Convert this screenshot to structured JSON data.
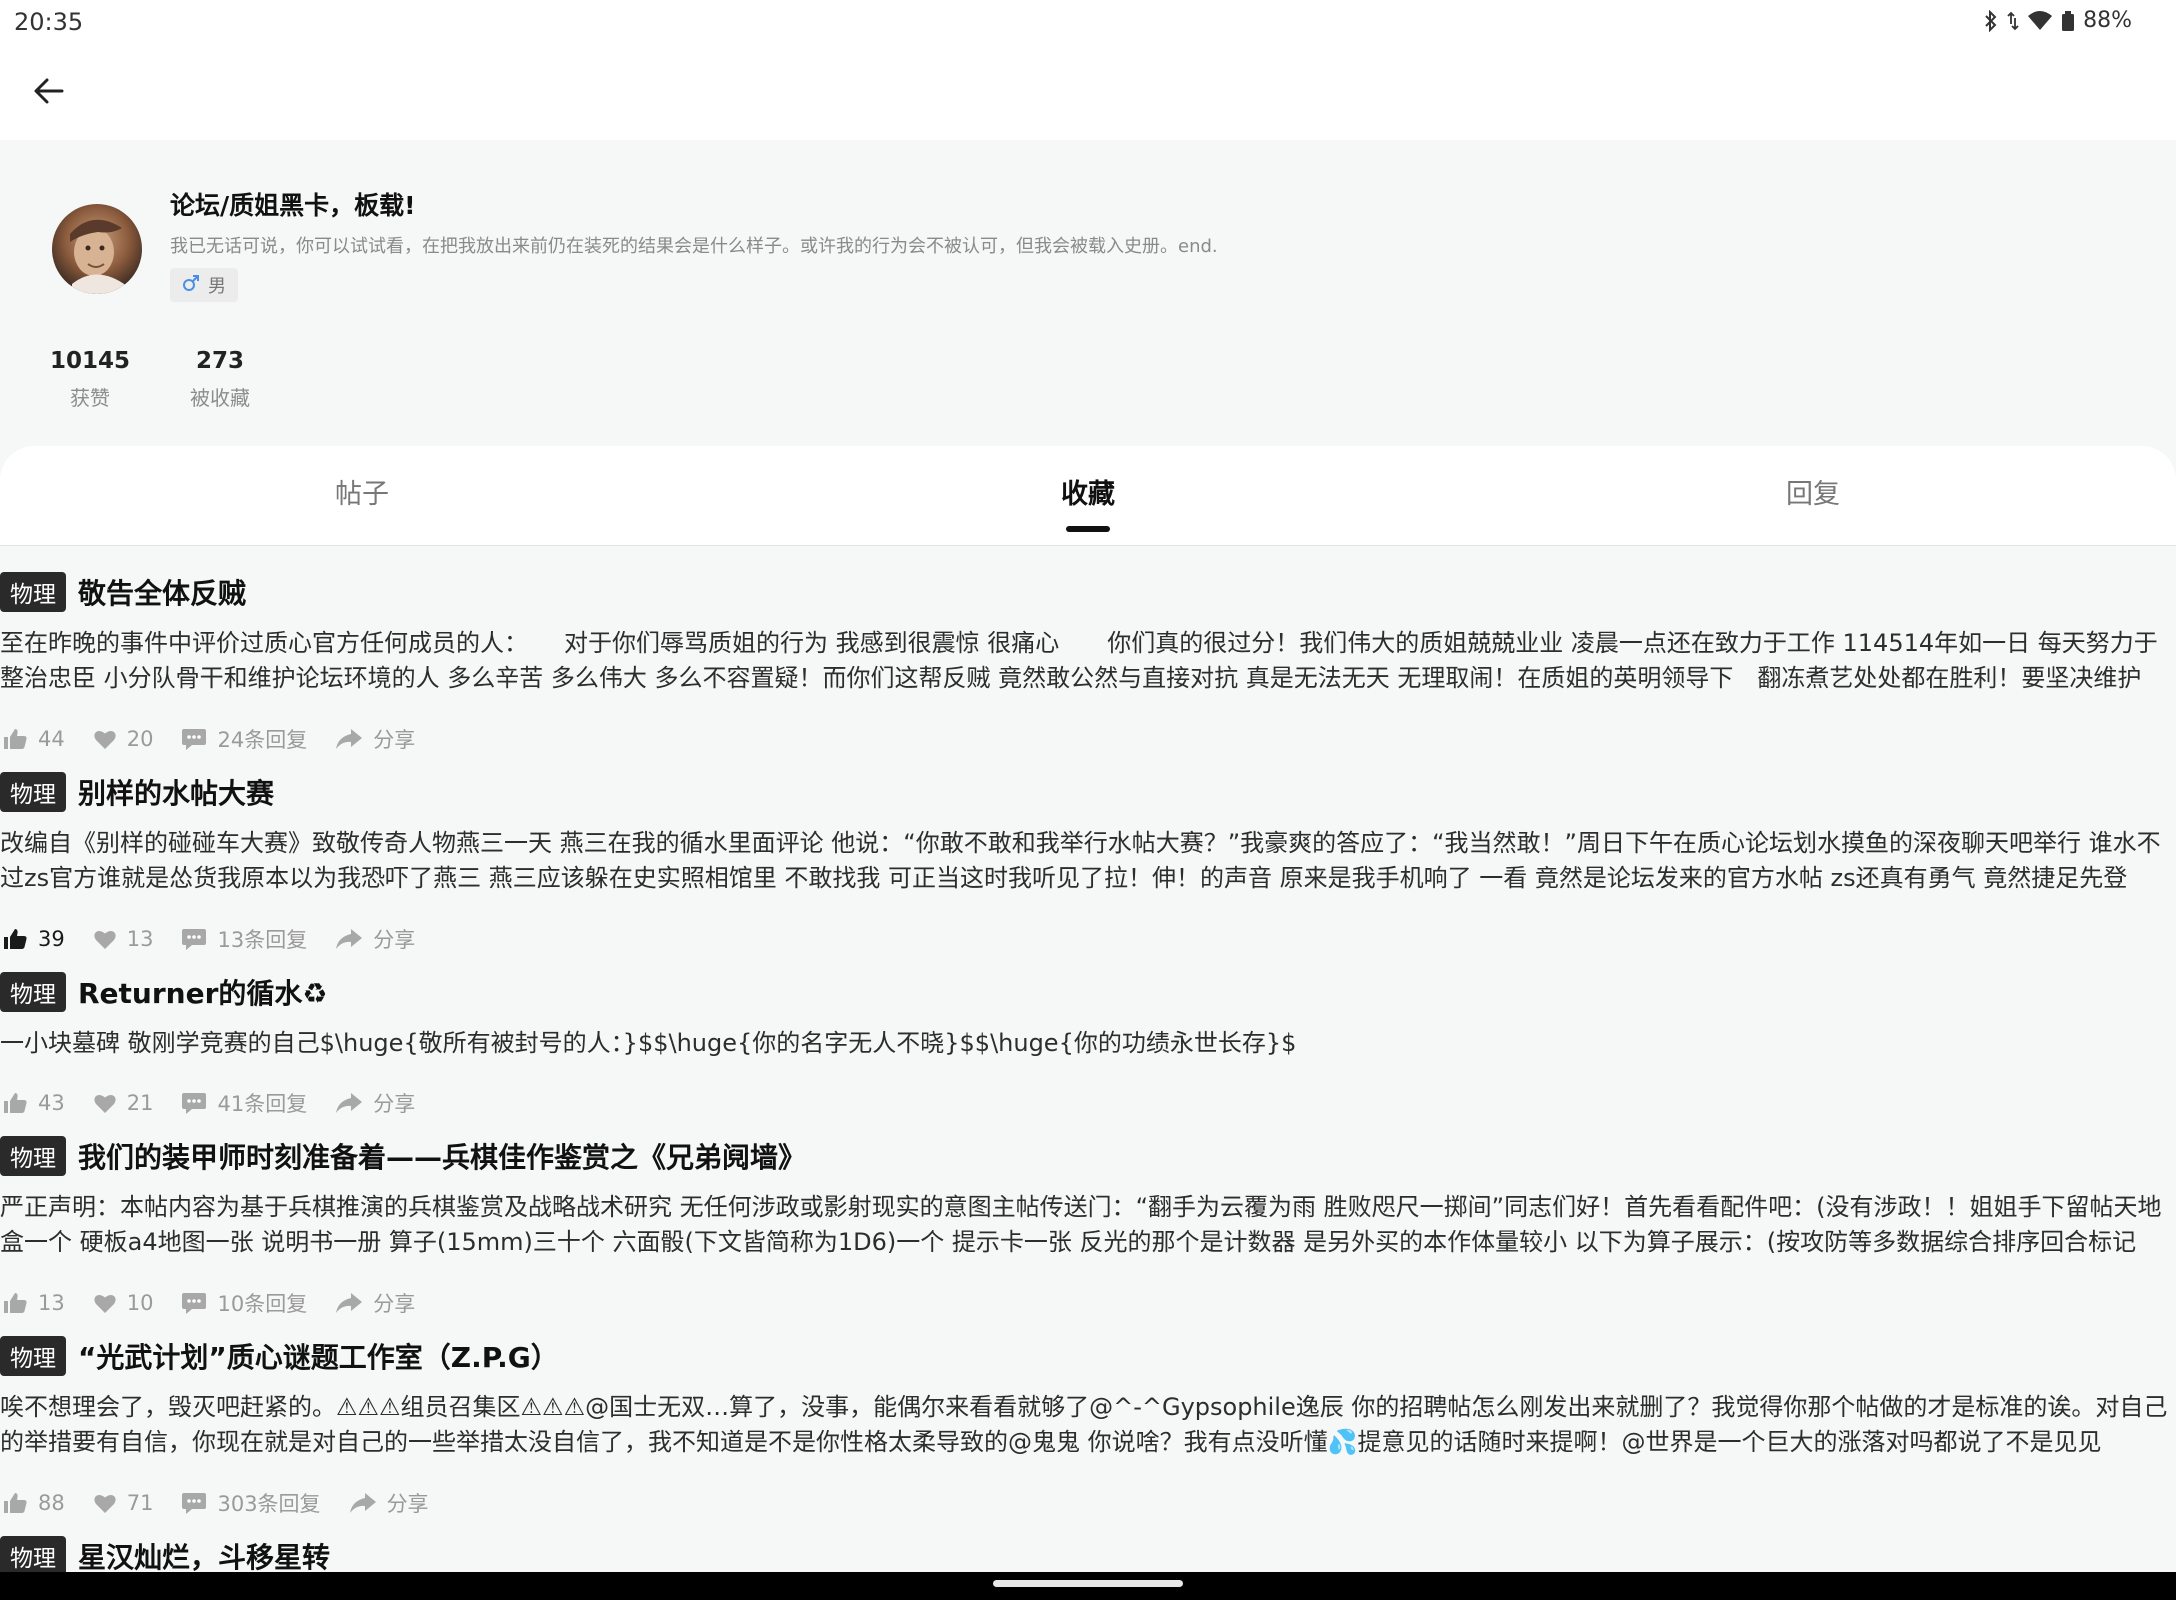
{
  "status_bar": {
    "time": "20:35",
    "battery": "88%"
  },
  "profile": {
    "name": "论坛/质姐黑卡，板载!",
    "bio": "我已无话可说，你可以试试看，在把我放出来前仍在装死的结果会是什么样子。或许我的行为会不被认可，但我会被载入史册。end.",
    "gender": "男",
    "stats": [
      {
        "value": "10145",
        "label": "获赞"
      },
      {
        "value": "273",
        "label": "被收藏"
      }
    ]
  },
  "tabs": [
    {
      "label": "帖子",
      "active": false
    },
    {
      "label": "收藏",
      "active": true
    },
    {
      "label": "回复",
      "active": false
    }
  ],
  "posts": [
    {
      "category": "物理",
      "title": "敬告全体反贼",
      "excerpt": "至在昨晚的事件中评价过质心官方任何成员的人：　　对于你们辱骂质姐的行为 我感到很震惊 很痛心　　你们真的很过分！我们伟大的质姐兢兢业业 凌晨一点还在致力于工作 114514年如一日 每天努力于整治忠臣 小分队骨干和维护论坛环境的人 多么辛苦 多么伟大 多么不容置疑！而你们这帮反贼 竟然敢公然与直接对抗 真是无法无天 无理取闹！在质姐的英明领导下　翻冻煮艺处处都在胜利！要坚决维护",
      "likes": "44",
      "favorites": "20",
      "replies": "24条回复",
      "share": "分享",
      "liked": false
    },
    {
      "category": "物理",
      "title": "别样的水帖大赛",
      "excerpt": "改编自《别样的碰碰车大赛》致敬传奇人物燕三一天 燕三在我的循水里面评论 他说：“你敢不敢和我举行水帖大赛？”我豪爽的答应了：“我当然敢！”周日下午在质心论坛划水摸鱼的深夜聊天吧举行 谁水不过zs官方谁就是怂货我原本以为我恐吓了燕三 燕三应该躲在史实照相馆里 不敢找我 可正当这时我听见了拉！伸！的声音 原来是我手机响了 一看 竟然是论坛发来的官方水帖 zs还真有勇气 竟然捷足先登",
      "likes": "39",
      "favorites": "13",
      "replies": "13条回复",
      "share": "分享",
      "liked": true
    },
    {
      "category": "物理",
      "title": "Returner的循水♻",
      "excerpt": "一小块墓碑 敬刚学竞赛的自己$\\huge{敬所有被封号的人：}$$\\huge{你的名字无人不晓}$$\\huge{你的功绩永世长存}$",
      "likes": "43",
      "favorites": "21",
      "replies": "41条回复",
      "share": "分享",
      "liked": false
    },
    {
      "category": "物理",
      "title": "我们的装甲师时刻准备着——兵棋佳作鉴赏之《兄弟阋墙》",
      "excerpt": "严正声明：本帖内容为基于兵棋推演的兵棋鉴赏及战略战术研究 无任何涉政或影射现实的意图主帖传送门：“翻手为云覆为雨 胜败咫尺一掷间”同志们好！首先看看配件吧：(没有涉政！！姐姐手下留帖天地盒一个 硬板a4地图一张 说明书一册 算子(15mm)三十个 六面骰(下文皆简称为1D6)一个 提示卡一张 反光的那个是计数器 是另外买的本作体量较小 以下为算子展示：(按攻防等多数据综合排序回合标记",
      "likes": "13",
      "favorites": "10",
      "replies": "10条回复",
      "share": "分享",
      "liked": false
    },
    {
      "category": "物理",
      "title": "“光武计划”质心谜题工作室（Z.P.G）",
      "excerpt": "唉不想理会了，毁灭吧赶紧的。⚠⚠⚠组员召集区⚠⚠⚠@国士无双…算了，没事，能偶尔来看看就够了@^-^Gypsophile逸辰 你的招聘帖怎么刚发出来就删了？我觉得你那个帖做的才是标准的诶。对自己的举措要有自信，你现在就是对自己的一些举措太没自信了，我不知道是不是你性格太柔导致的@鬼鬼 你说啥？我有点没听懂💦提意见的话随时来提啊！@世界是一个巨大的涨落对吗都说了不是见见",
      "likes": "88",
      "favorites": "71",
      "replies": "303条回复",
      "share": "分享",
      "liked": false
    }
  ],
  "last_post": {
    "category": "物理",
    "title": "星汉灿烂，斗移星转"
  }
}
